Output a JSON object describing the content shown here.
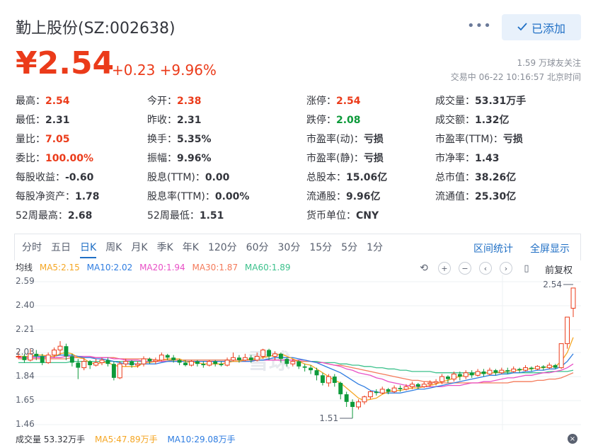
{
  "header": {
    "title": "勤上股份(SZ:002638)",
    "more": "•••",
    "added_label": "已添加"
  },
  "price": {
    "current": "¥2.54",
    "change": "+0.23 +9.96%",
    "followers": "1.59 万球友关注",
    "trade_time": "交易中 06-22 10:16:57 北京时间"
  },
  "quote": [
    [
      {
        "label": "最高：",
        "value": "2.54",
        "cls": "up"
      },
      {
        "label": "今开：",
        "value": "2.38",
        "cls": "up"
      },
      {
        "label": "涨停：",
        "value": "2.54",
        "cls": "up"
      },
      {
        "label": "成交量：",
        "value": "53.31万手",
        "cls": ""
      }
    ],
    [
      {
        "label": "最低：",
        "value": "2.31",
        "cls": ""
      },
      {
        "label": "昨收：",
        "value": "2.31",
        "cls": ""
      },
      {
        "label": "跌停：",
        "value": "2.08",
        "cls": "down"
      },
      {
        "label": "成交额：",
        "value": "1.32亿",
        "cls": ""
      }
    ],
    [
      {
        "label": "量比：",
        "value": "7.05",
        "cls": "up"
      },
      {
        "label": "换手：",
        "value": "5.35%",
        "cls": ""
      },
      {
        "label": "市盈率(动)：",
        "value": "亏损",
        "cls": ""
      },
      {
        "label": "市盈率(TTM)：",
        "value": "亏损",
        "cls": ""
      }
    ],
    [
      {
        "label": "委比：",
        "value": "100.00%",
        "cls": "up"
      },
      {
        "label": "振幅：",
        "value": "9.96%",
        "cls": ""
      },
      {
        "label": "市盈率(静)：",
        "value": "亏损",
        "cls": ""
      },
      {
        "label": "市净率：",
        "value": "1.43",
        "cls": ""
      }
    ],
    [
      {
        "label": "每股收益：",
        "value": "-0.60",
        "cls": ""
      },
      {
        "label": "股息(TTM)：",
        "value": "0.00",
        "cls": ""
      },
      {
        "label": "总股本：",
        "value": "15.06亿",
        "cls": ""
      },
      {
        "label": "总市值：",
        "value": "38.26亿",
        "cls": ""
      }
    ],
    [
      {
        "label": "每股净资产：",
        "value": "1.78",
        "cls": ""
      },
      {
        "label": "股息率(TTM)：",
        "value": "0.00%",
        "cls": ""
      },
      {
        "label": "流通股：",
        "value": "9.96亿",
        "cls": ""
      },
      {
        "label": "流通值：",
        "value": "25.30亿",
        "cls": ""
      }
    ],
    [
      {
        "label": "52周最高：",
        "value": "2.68",
        "cls": ""
      },
      {
        "label": "52周最低：",
        "value": "1.51",
        "cls": ""
      },
      {
        "label": "货币单位：",
        "value": "CNY",
        "cls": ""
      },
      {
        "label": "",
        "value": "",
        "cls": ""
      }
    ]
  ],
  "tabs": [
    "分时",
    "五日",
    "日K",
    "周K",
    "月K",
    "季K",
    "年K",
    "120分",
    "60分",
    "30分",
    "15分",
    "5分",
    "1分"
  ],
  "active_tab": 2,
  "tab_links": {
    "range": "区间统计",
    "fullscreen": "全屏显示"
  },
  "ma": {
    "label": "均线",
    "ma5": "MA5:2.15",
    "ma10": "MA10:2.02",
    "ma20": "MA20:1.94",
    "ma30": "MA30:1.87",
    "ma60": "MA60:1.89",
    "colors": {
      "ma5": "#f5a623",
      "ma10": "#2f7de1",
      "ma20": "#e84fc6",
      "ma30": "#f47a5a",
      "ma60": "#3cc18c"
    }
  },
  "toolbar": {
    "adjust": "前复权"
  },
  "chart_data": {
    "type": "candlestick",
    "y_ticks": [
      "2.59",
      "2.40",
      "2.21",
      "2.03",
      "1.84",
      "1.65",
      "1.46"
    ],
    "ylim": [
      1.46,
      2.59
    ],
    "annotations": {
      "high": "2.54",
      "low": "1.51"
    },
    "up_color": "#eb3b1a",
    "down_color": "#0d9a3a",
    "candles": [
      [
        2.0,
        2.0,
        1.98,
        2.04
      ],
      [
        2.0,
        1.97,
        1.95,
        2.02
      ],
      [
        1.97,
        2.02,
        1.96,
        2.06
      ],
      [
        2.02,
        2.0,
        1.97,
        2.05
      ],
      [
        2.0,
        1.95,
        1.93,
        2.02
      ],
      [
        1.95,
        2.01,
        1.94,
        2.03
      ],
      [
        2.01,
        2.05,
        1.99,
        2.07
      ],
      [
        2.05,
        2.08,
        2.01,
        2.12
      ],
      [
        2.08,
        2.0,
        1.97,
        2.1
      ],
      [
        2.0,
        1.95,
        1.92,
        2.02
      ],
      [
        1.95,
        1.91,
        1.82,
        1.98
      ],
      [
        1.91,
        1.96,
        1.89,
        1.99
      ],
      [
        1.96,
        1.93,
        1.9,
        1.97
      ],
      [
        1.93,
        1.95,
        1.92,
        1.98
      ],
      [
        1.95,
        1.97,
        1.93,
        1.99
      ],
      [
        1.97,
        1.94,
        1.92,
        1.99
      ],
      [
        1.94,
        1.83,
        1.81,
        1.96
      ],
      [
        1.83,
        1.94,
        1.82,
        1.96
      ],
      [
        1.94,
        1.96,
        1.92,
        1.98
      ],
      [
        1.96,
        1.93,
        1.91,
        1.97
      ],
      [
        1.93,
        1.94,
        1.91,
        1.96
      ],
      [
        1.94,
        1.98,
        1.92,
        2.0
      ],
      [
        1.98,
        1.96,
        1.94,
        1.99
      ],
      [
        1.96,
        1.97,
        1.94,
        1.99
      ],
      [
        1.97,
        2.01,
        1.96,
        2.03
      ],
      [
        2.01,
        1.99,
        1.97,
        2.02
      ],
      [
        1.99,
        1.97,
        1.95,
        2.01
      ],
      [
        1.97,
        1.95,
        1.93,
        1.98
      ],
      [
        1.95,
        1.93,
        1.92,
        1.97
      ],
      [
        1.93,
        1.96,
        1.92,
        1.97
      ],
      [
        1.96,
        1.94,
        1.92,
        1.97
      ],
      [
        1.94,
        1.93,
        1.91,
        1.96
      ],
      [
        1.93,
        1.96,
        1.92,
        1.97
      ],
      [
        1.96,
        1.94,
        1.92,
        1.97
      ],
      [
        1.94,
        1.93,
        1.92,
        1.96
      ],
      [
        1.93,
        1.97,
        1.92,
        1.99
      ],
      [
        1.97,
        1.99,
        1.96,
        2.03
      ],
      [
        1.99,
        1.97,
        1.95,
        2.01
      ],
      [
        1.97,
        1.99,
        1.96,
        2.02
      ],
      [
        1.99,
        1.97,
        1.95,
        2.01
      ],
      [
        1.97,
        2.0,
        1.96,
        2.03
      ],
      [
        2.0,
        2.05,
        1.98,
        2.06
      ],
      [
        2.05,
        2.0,
        1.97,
        2.06
      ],
      [
        2.0,
        2.02,
        1.97,
        2.04
      ],
      [
        2.02,
        1.98,
        1.95,
        2.03
      ],
      [
        1.98,
        1.94,
        1.92,
        1.99
      ],
      [
        1.94,
        1.96,
        1.92,
        1.98
      ],
      [
        1.96,
        1.92,
        1.9,
        1.97
      ],
      [
        1.92,
        1.91,
        1.88,
        1.94
      ],
      [
        1.91,
        1.89,
        1.86,
        1.93
      ],
      [
        1.89,
        1.85,
        1.81,
        1.91
      ],
      [
        1.85,
        1.79,
        1.77,
        1.87
      ],
      [
        1.79,
        1.84,
        1.76,
        1.86
      ],
      [
        1.84,
        1.79,
        1.76,
        1.86
      ],
      [
        1.79,
        1.7,
        1.66,
        1.8
      ],
      [
        1.7,
        1.64,
        1.6,
        1.72
      ],
      [
        1.64,
        1.6,
        1.51,
        1.66
      ],
      [
        1.6,
        1.64,
        1.58,
        1.66
      ],
      [
        1.64,
        1.68,
        1.62,
        1.69
      ],
      [
        1.68,
        1.72,
        1.66,
        1.73
      ],
      [
        1.72,
        1.71,
        1.69,
        1.74
      ],
      [
        1.71,
        1.74,
        1.7,
        1.76
      ],
      [
        1.74,
        1.72,
        1.7,
        1.75
      ],
      [
        1.72,
        1.75,
        1.71,
        1.77
      ],
      [
        1.75,
        1.74,
        1.72,
        1.77
      ],
      [
        1.74,
        1.76,
        1.73,
        1.78
      ],
      [
        1.76,
        1.78,
        1.74,
        1.8
      ],
      [
        1.78,
        1.76,
        1.74,
        1.79
      ],
      [
        1.76,
        1.78,
        1.75,
        1.8
      ],
      [
        1.78,
        1.79,
        1.76,
        1.81
      ],
      [
        1.79,
        1.8,
        1.77,
        1.82
      ],
      [
        1.8,
        1.84,
        1.78,
        1.86
      ],
      [
        1.84,
        1.82,
        1.79,
        1.85
      ],
      [
        1.82,
        1.86,
        1.8,
        1.88
      ],
      [
        1.86,
        1.84,
        1.81,
        1.88
      ],
      [
        1.84,
        1.87,
        1.82,
        1.89
      ],
      [
        1.87,
        1.85,
        1.83,
        1.89
      ],
      [
        1.85,
        1.88,
        1.84,
        1.9
      ],
      [
        1.88,
        1.86,
        1.84,
        1.9
      ],
      [
        1.86,
        1.89,
        1.85,
        1.91
      ],
      [
        1.89,
        1.87,
        1.85,
        1.9
      ],
      [
        1.87,
        1.89,
        1.86,
        1.91
      ],
      [
        1.89,
        1.88,
        1.86,
        1.91
      ],
      [
        1.88,
        1.9,
        1.87,
        1.92
      ],
      [
        1.9,
        1.89,
        1.87,
        1.91
      ],
      [
        1.89,
        1.91,
        1.88,
        1.93
      ],
      [
        1.91,
        1.9,
        1.88,
        1.92
      ],
      [
        1.9,
        1.92,
        1.89,
        1.93
      ],
      [
        1.92,
        1.91,
        1.89,
        1.93
      ],
      [
        1.91,
        1.93,
        1.9,
        1.95
      ],
      [
        1.93,
        1.91,
        1.9,
        1.94
      ],
      [
        1.91,
        2.1,
        1.9,
        2.1
      ],
      [
        2.1,
        2.31,
        2.06,
        2.31
      ],
      [
        2.38,
        2.54,
        2.31,
        2.54
      ]
    ],
    "ma_series": {
      "ma5": [
        2.0,
        2.0,
        2.0,
        2.01,
        2.01,
        2.0,
        2.0,
        2.02,
        2.03,
        2.02,
        1.99,
        1.98,
        1.95,
        1.94,
        1.95,
        1.95,
        1.93,
        1.92,
        1.92,
        1.92,
        1.92,
        1.95,
        1.95,
        1.96,
        1.97,
        1.98,
        1.98,
        1.98,
        1.96,
        1.95,
        1.95,
        1.94,
        1.94,
        1.94,
        1.94,
        1.95,
        1.96,
        1.96,
        1.97,
        1.98,
        1.98,
        1.99,
        2.0,
        2.01,
        2.02,
        2.0,
        1.98,
        1.96,
        1.94,
        1.93,
        1.9,
        1.87,
        1.84,
        1.81,
        1.79,
        1.75,
        1.71,
        1.67,
        1.65,
        1.66,
        1.67,
        1.7,
        1.72,
        1.73,
        1.73,
        1.74,
        1.75,
        1.75,
        1.76,
        1.77,
        1.78,
        1.8,
        1.81,
        1.83,
        1.84,
        1.85,
        1.86,
        1.86,
        1.87,
        1.87,
        1.87,
        1.88,
        1.88,
        1.89,
        1.89,
        1.9,
        1.9,
        1.91,
        1.91,
        1.92,
        1.92,
        1.96,
        2.03,
        2.15
      ],
      "ma10": [
        2.0,
        2.0,
        2.0,
        2.0,
        2.0,
        2.0,
        2.0,
        2.01,
        2.01,
        2.01,
        2.0,
        1.99,
        1.99,
        1.98,
        1.98,
        1.97,
        1.96,
        1.95,
        1.94,
        1.94,
        1.94,
        1.94,
        1.94,
        1.94,
        1.95,
        1.96,
        1.96,
        1.96,
        1.96,
        1.96,
        1.96,
        1.96,
        1.96,
        1.96,
        1.96,
        1.96,
        1.96,
        1.96,
        1.96,
        1.96,
        1.97,
        1.97,
        1.98,
        1.99,
        1.99,
        1.99,
        1.99,
        1.98,
        1.97,
        1.96,
        1.95,
        1.93,
        1.91,
        1.89,
        1.87,
        1.84,
        1.81,
        1.78,
        1.76,
        1.73,
        1.72,
        1.71,
        1.71,
        1.71,
        1.71,
        1.72,
        1.73,
        1.74,
        1.74,
        1.75,
        1.76,
        1.77,
        1.78,
        1.79,
        1.8,
        1.81,
        1.82,
        1.83,
        1.84,
        1.85,
        1.85,
        1.86,
        1.86,
        1.87,
        1.87,
        1.88,
        1.88,
        1.89,
        1.89,
        1.9,
        1.9,
        1.92,
        1.96,
        2.02
      ],
      "ma20": [
        1.99,
        1.99,
        1.99,
        1.99,
        1.99,
        1.99,
        1.99,
        1.99,
        2.0,
        2.0,
        2.0,
        2.0,
        2.0,
        1.99,
        1.99,
        1.99,
        1.98,
        1.98,
        1.97,
        1.97,
        1.97,
        1.96,
        1.96,
        1.96,
        1.96,
        1.96,
        1.96,
        1.96,
        1.96,
        1.96,
        1.96,
        1.96,
        1.96,
        1.96,
        1.96,
        1.96,
        1.96,
        1.96,
        1.96,
        1.96,
        1.97,
        1.97,
        1.97,
        1.97,
        1.97,
        1.97,
        1.97,
        1.97,
        1.97,
        1.96,
        1.95,
        1.95,
        1.94,
        1.93,
        1.92,
        1.9,
        1.89,
        1.87,
        1.86,
        1.85,
        1.83,
        1.82,
        1.8,
        1.79,
        1.78,
        1.77,
        1.77,
        1.76,
        1.76,
        1.76,
        1.76,
        1.76,
        1.77,
        1.77,
        1.77,
        1.78,
        1.79,
        1.79,
        1.8,
        1.8,
        1.81,
        1.82,
        1.83,
        1.83,
        1.84,
        1.85,
        1.85,
        1.86,
        1.87,
        1.87,
        1.88,
        1.89,
        1.91,
        1.94
      ],
      "ma30": [
        1.98,
        1.98,
        1.98,
        1.98,
        1.98,
        1.98,
        1.98,
        1.98,
        1.98,
        1.99,
        1.99,
        1.99,
        1.99,
        1.99,
        1.99,
        1.99,
        1.99,
        1.98,
        1.98,
        1.98,
        1.98,
        1.98,
        1.98,
        1.97,
        1.97,
        1.97,
        1.97,
        1.97,
        1.97,
        1.97,
        1.97,
        1.97,
        1.97,
        1.97,
        1.97,
        1.97,
        1.97,
        1.97,
        1.97,
        1.97,
        1.97,
        1.97,
        1.97,
        1.97,
        1.97,
        1.97,
        1.97,
        1.96,
        1.96,
        1.96,
        1.95,
        1.95,
        1.94,
        1.93,
        1.93,
        1.92,
        1.91,
        1.9,
        1.89,
        1.88,
        1.87,
        1.86,
        1.85,
        1.84,
        1.83,
        1.82,
        1.81,
        1.81,
        1.8,
        1.8,
        1.79,
        1.79,
        1.79,
        1.79,
        1.79,
        1.79,
        1.79,
        1.79,
        1.79,
        1.79,
        1.79,
        1.79,
        1.79,
        1.8,
        1.8,
        1.8,
        1.8,
        1.81,
        1.81,
        1.82,
        1.82,
        1.83,
        1.85,
        1.87
      ],
      "ma60": [
        1.95,
        1.95,
        1.95,
        1.95,
        1.95,
        1.95,
        1.95,
        1.95,
        1.95,
        1.96,
        1.96,
        1.96,
        1.96,
        1.96,
        1.96,
        1.96,
        1.96,
        1.96,
        1.96,
        1.96,
        1.96,
        1.96,
        1.96,
        1.96,
        1.96,
        1.96,
        1.97,
        1.97,
        1.97,
        1.97,
        1.97,
        1.97,
        1.97,
        1.97,
        1.97,
        1.97,
        1.97,
        1.97,
        1.97,
        1.97,
        1.97,
        1.97,
        1.97,
        1.97,
        1.97,
        1.97,
        1.97,
        1.96,
        1.96,
        1.96,
        1.96,
        1.95,
        1.95,
        1.95,
        1.94,
        1.94,
        1.93,
        1.93,
        1.92,
        1.92,
        1.91,
        1.91,
        1.9,
        1.9,
        1.89,
        1.89,
        1.88,
        1.88,
        1.88,
        1.88,
        1.87,
        1.87,
        1.87,
        1.87,
        1.87,
        1.87,
        1.87,
        1.87,
        1.87,
        1.87,
        1.87,
        1.87,
        1.87,
        1.87,
        1.87,
        1.87,
        1.87,
        1.87,
        1.87,
        1.88,
        1.88,
        1.88,
        1.88,
        1.89
      ]
    }
  },
  "volume": {
    "total": "成交量 53.32万手",
    "ma5": "MA5:47.89万手",
    "ma10": "MA10:29.08万手",
    "close": "×"
  },
  "watermark": "雪球"
}
